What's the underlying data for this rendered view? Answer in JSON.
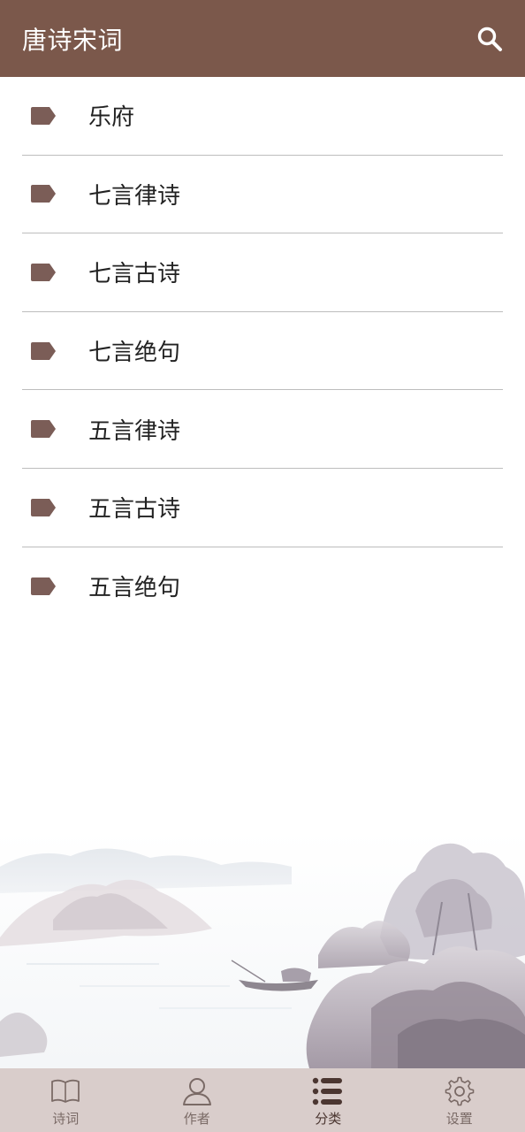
{
  "app": {
    "title": "唐诗宋词"
  },
  "categories": [
    {
      "label": "乐府"
    },
    {
      "label": "七言律诗"
    },
    {
      "label": "七言古诗"
    },
    {
      "label": "七言绝句"
    },
    {
      "label": "五言律诗"
    },
    {
      "label": "五言古诗"
    },
    {
      "label": "五言绝句"
    }
  ],
  "bottom_nav": {
    "tabs": [
      {
        "label": "诗词",
        "icon": "book-icon"
      },
      {
        "label": "作者",
        "icon": "person-icon"
      },
      {
        "label": "分类",
        "icon": "list-icon",
        "active": true
      },
      {
        "label": "设置",
        "icon": "gear-icon"
      }
    ]
  },
  "colors": {
    "header": "#7b584b",
    "tag": "#7b5d57",
    "nav_bg": "#d9cdcb"
  }
}
